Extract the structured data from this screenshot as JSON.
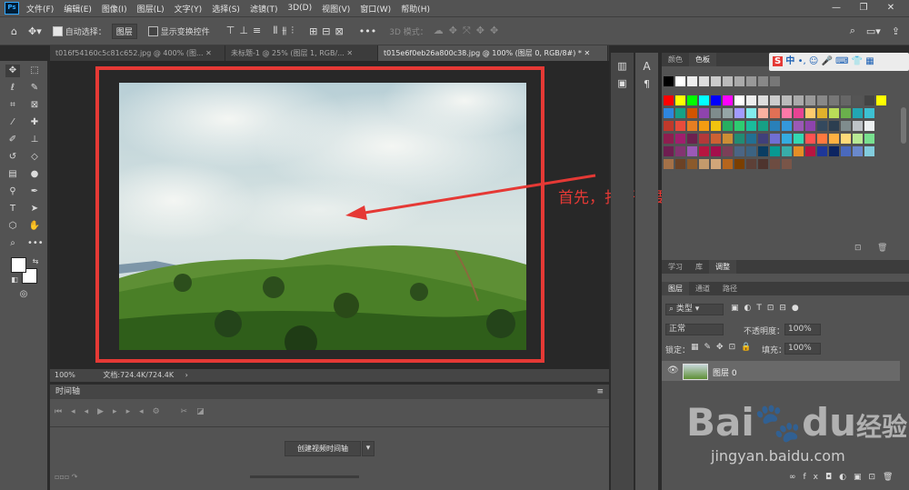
{
  "menu": {
    "logo": "Ps",
    "items": [
      "文件(F)",
      "编辑(E)",
      "图像(I)",
      "图层(L)",
      "文字(Y)",
      "选择(S)",
      "滤镜(T)",
      "3D(D)",
      "视图(V)",
      "窗口(W)",
      "帮助(H)"
    ],
    "minimize": "—",
    "restore": "❐",
    "close": "✕"
  },
  "options": {
    "auto_select_label": "自动选择：",
    "auto_select_value": "图层",
    "show_transform_label": "显示变换控件",
    "more": "•••",
    "mode_3d": "3D 模式："
  },
  "tabs": [
    {
      "label": "t016f54160c5c81c652.jpg @ 400% (图...",
      "close": "✕"
    },
    {
      "label": "未标题-1 @ 25% (图层 1, RGB/...",
      "close": "✕"
    },
    {
      "label": "t015e6f0eb26a800c38.jpg @ 100% (图层 0, RGB/8#) *",
      "close": "✕"
    }
  ],
  "annotation": "首先，打开需要进行抠图的图片",
  "status": {
    "zoom": "100%",
    "doc": "文档:724.4K/724.4K",
    "arrow": "›"
  },
  "timeline": {
    "title": "时间轴",
    "create_button": "创建视频时间轴",
    "dropdown": "▾"
  },
  "right": {
    "tabs_top": [
      "颜色",
      "色板"
    ],
    "tabs_mid": [
      "学习",
      "库",
      "调整"
    ],
    "tabs_layers": [
      "图层",
      "通道",
      "路径"
    ],
    "filter_kind": "类型",
    "blend_mode": "正常",
    "opacity_label": "不透明度：",
    "opacity_value": "100%",
    "lock_label": "锁定：",
    "fill_label": "填充：",
    "fill_value": "100%",
    "layer_name": "图层 0",
    "fx": "fx"
  },
  "ime": {
    "lang": "中",
    "punct": "•,"
  },
  "watermark": {
    "brand": "Bai",
    "brand2": "du",
    "jingyan": "经验",
    "url": "jingyan.baidu.com"
  },
  "colors": {
    "accent": "#31a8ff",
    "annotation": "#e53935",
    "panel": "#535353"
  }
}
